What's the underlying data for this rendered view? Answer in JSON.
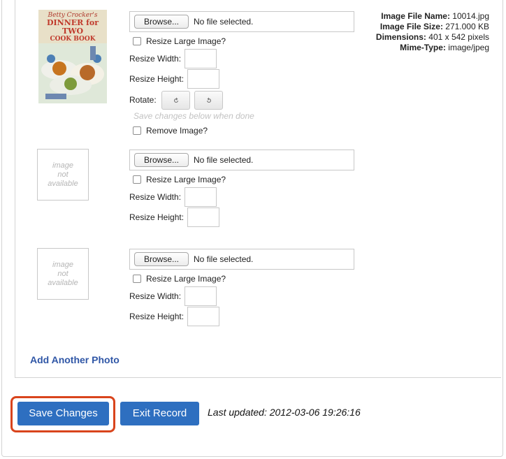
{
  "photos": [
    {
      "has_image": true,
      "browse_label": "Browse...",
      "file_status": "No file selected.",
      "resize_large_label": "Resize Large Image?",
      "resize_width_label": "Resize Width:",
      "resize_height_label": "Resize Height:",
      "rotate_label": "Rotate:",
      "hint": "Save changes below when done",
      "remove_label": "Remove Image?",
      "meta": {
        "file_name_label": "Image File Name:",
        "file_name": "10014.jpg",
        "file_size_label": "Image File Size:",
        "file_size": "271.000 KB",
        "dimensions_label": "Dimensions:",
        "dimensions": "401 x 542 pixels",
        "mime_label": "Mime-Type:",
        "mime": "image/jpeg"
      },
      "cover": {
        "line1": "Betty Crocker's",
        "line2": "DINNER for TWO",
        "line3": "COOK BOOK"
      }
    },
    {
      "has_image": false,
      "placeholder": [
        "image",
        "not",
        "available"
      ],
      "browse_label": "Browse...",
      "file_status": "No file selected.",
      "resize_large_label": "Resize Large Image?",
      "resize_width_label": "Resize Width:",
      "resize_height_label": "Resize Height:"
    },
    {
      "has_image": false,
      "placeholder": [
        "image",
        "not",
        "available"
      ],
      "browse_label": "Browse...",
      "file_status": "No file selected.",
      "resize_large_label": "Resize Large Image?",
      "resize_width_label": "Resize Width:",
      "resize_height_label": "Resize Height:"
    }
  ],
  "add_photo_label": "Add Another Photo",
  "save_label": "Save Changes",
  "exit_label": "Exit Record",
  "last_updated": "Last updated: 2012-03-06 19:26:16",
  "colors": {
    "primary_button": "#2e6fc0",
    "link": "#2f56a6",
    "highlight": "#d9441c"
  }
}
